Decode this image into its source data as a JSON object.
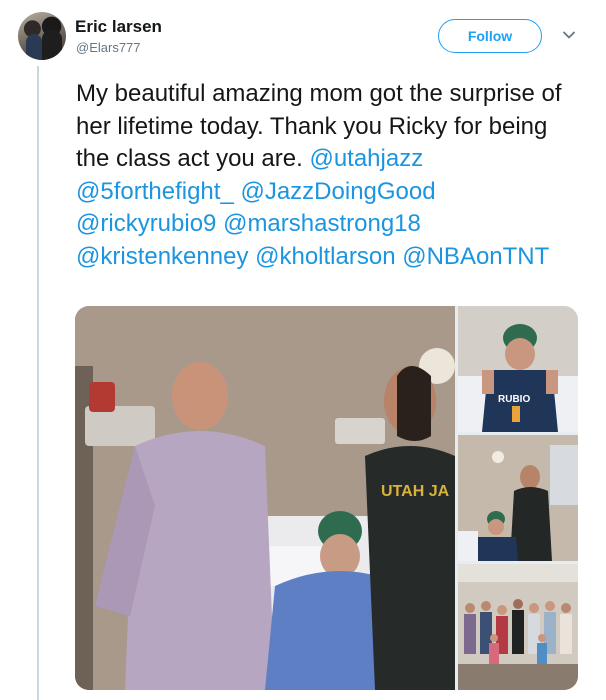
{
  "author": {
    "name": "Eric larsen",
    "handle": "@Elars777"
  },
  "actions": {
    "follow_label": "Follow"
  },
  "tweet": {
    "text_plain": "My beautiful amazing mom got the surprise of her lifetime today. Thank you Ricky for being the class act you are.",
    "mentions": [
      "@utahjazz",
      "@5forthefight_",
      "@JazzDoingGood",
      "@rickyrubio9",
      "@marshastrong18",
      "@kristenkenney",
      "@kholtlarson",
      "@NBAonTNT"
    ]
  },
  "media": {
    "jersey_text": "RUBIO",
    "shirt_text": "UTAH JA"
  },
  "colors": {
    "link": "#1b95e0",
    "follow": "#1da1f2",
    "secondary_text": "#657786"
  },
  "icons": {
    "more": "chevron-down-icon"
  }
}
